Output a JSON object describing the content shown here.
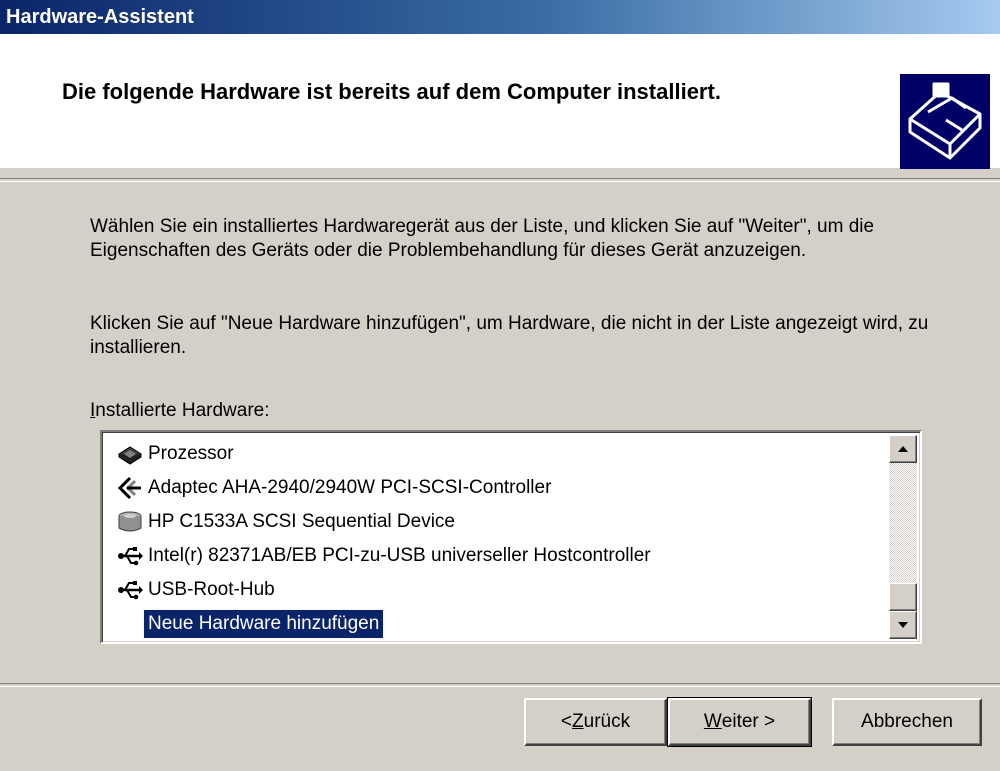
{
  "window": {
    "title": "Hardware-Assistent"
  },
  "header": {
    "title": "Die folgende Hardware ist bereits auf dem Computer installiert."
  },
  "body": {
    "paragraph1": "Wählen Sie ein installiertes Hardwaregerät aus der Liste, und klicken Sie auf \"Weiter\", um die Eigenschaften des Geräts oder die Problembehandlung für dieses Gerät anzuzeigen.",
    "paragraph2": "Klicken Sie auf \"Neue Hardware hinzufügen\", um Hardware, die nicht in der Liste angezeigt wird, zu installieren.",
    "list_label_first": "I",
    "list_label_rest": "nstallierte Hardware:"
  },
  "list": {
    "items": [
      {
        "label": "Prozessor",
        "icon": "cpu-icon"
      },
      {
        "label": "Adaptec AHA-2940/2940W PCI-SCSI-Controller",
        "icon": "scsi-controller-icon"
      },
      {
        "label": "HP C1533A SCSI Sequential Device",
        "icon": "tape-drive-icon"
      },
      {
        "label": "Intel(r) 82371AB/EB PCI-zu-USB universeller Hostcontroller",
        "icon": "usb-icon"
      },
      {
        "label": "USB-Root-Hub",
        "icon": "usb-icon"
      },
      {
        "label": "Neue Hardware hinzufügen",
        "icon": "none",
        "selected": true
      }
    ]
  },
  "buttons": {
    "back_prefix": "< ",
    "back_mnemonic": "Z",
    "back_rest": "urück",
    "next_mnemonic": "W",
    "next_rest": "eiter >",
    "cancel": "Abbrechen"
  },
  "colors": {
    "selection": "#0a246a",
    "face": "#d4d0c8"
  }
}
